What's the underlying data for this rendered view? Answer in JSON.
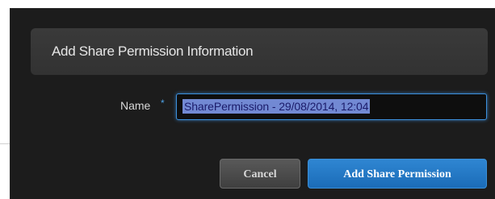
{
  "dialog": {
    "title": "Add Share Permission Information",
    "name_field": {
      "label": "Name",
      "required_marker": "*",
      "value": "SharePermission - 29/08/2014, 12:04"
    },
    "buttons": {
      "cancel": "Cancel",
      "submit": "Add Share Permission"
    }
  },
  "colors": {
    "modal_background": "#1c1c1c",
    "header_background": "#353535",
    "accent": "#3c8fdc",
    "primary_button": "#2478c4"
  }
}
